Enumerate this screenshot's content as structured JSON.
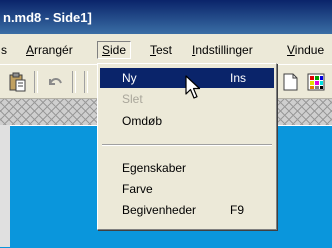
{
  "window": {
    "title": "n.md8 - Side1]"
  },
  "menubar": {
    "left_fragment": "s",
    "items": [
      {
        "accel": "A",
        "rest": "rrangér"
      },
      {
        "accel": "S",
        "rest": "ide"
      },
      {
        "accel": "T",
        "rest": "est"
      },
      {
        "accel": "I",
        "rest": "ndstillinger"
      },
      {
        "accel": "V",
        "rest": "indue"
      }
    ]
  },
  "toolbar": {
    "icons": [
      "paste-icon",
      "undo-icon",
      "new-page-icon",
      "color-grid-icon"
    ]
  },
  "side_menu": {
    "items": [
      {
        "label": "Ny",
        "shortcut": "Ins",
        "state": "selected"
      },
      {
        "label": "Slet",
        "shortcut": "",
        "state": "disabled"
      },
      {
        "label": "Omdøb",
        "shortcut": "",
        "state": "normal"
      },
      {
        "label": "Egenskaber",
        "shortcut": "",
        "state": "normal"
      },
      {
        "label": "Farve",
        "shortcut": "",
        "state": "normal"
      },
      {
        "label": "Begivenheder",
        "shortcut": "F9",
        "state": "normal"
      }
    ]
  },
  "colors": {
    "titlebar_start": "#0a246a",
    "menu_highlight": "#0a246a",
    "panel_blue": "#0a96dc",
    "disabled_text": "#a9a69b"
  }
}
